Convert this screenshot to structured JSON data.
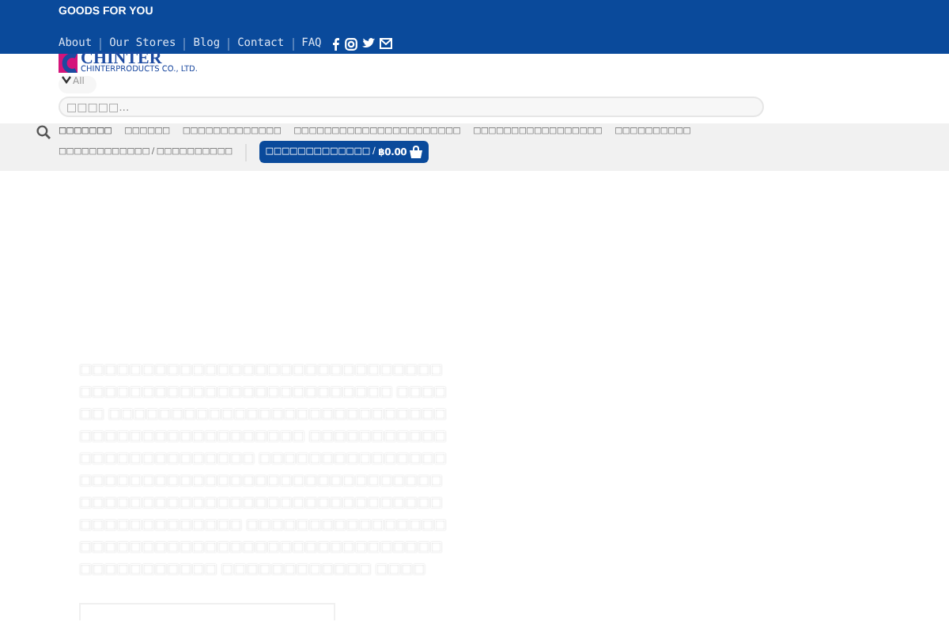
{
  "topbar": {
    "tagline": "GOODS FOR YOU",
    "links": [
      "About",
      "Our Stores",
      "Blog",
      "Contact",
      "FAQ"
    ],
    "social": [
      {
        "kind": "facebook"
      },
      {
        "kind": "instagram"
      },
      {
        "kind": "twitter"
      },
      {
        "kind": "email"
      }
    ]
  },
  "logo": {
    "name": "CHINTER",
    "subtitle": "CHINTERPRODUCTS CO., LTD."
  },
  "search": {
    "category": "All",
    "placeholder": "□□□□□..."
  },
  "menu": {
    "items": [
      "□□□□□□□",
      "□□□□□□",
      "□□□□□□□□□□□□□",
      "□□□□□□□□□□□□□□□□□□□□□□",
      "□□□□□□□□□□□□□□□□□",
      "□□□□□□□□□□",
      "□□□□□□□□□□□□ / □□□□□□□□□□"
    ],
    "cart": {
      "label": "□□□□□□□□□□□□□ /",
      "amount": "฿0.00"
    }
  },
  "hero": {
    "text": "□□□□□□□□□□□□□□□□□□□□□□□□□□□□□□□□□□□□□□□□□□□□□□□□□□□□□□ □□□□□□ □□□□□□□□□□□□□□□□□□□□□□□□□□□□□□□□□□□□□□□□□□□□□ □□□□□□□□□□□□□□□□□□□□□□□□□ □□□□□□□□□□□□□□□□□□□□□□□□□□□□□□□□□□□□□□□□□□□□□□□□□□□□□□□□□□□□□□□□□□□□□□□□□□□□□□□□□□□□□□ □□□□□□□□□□□□□□□□□□□□□□□□□□□□□□□□□□□□□□□□□□□□□□□□□□□□□□□□ □□□□□□□□□□□□ □□□□"
  }
}
